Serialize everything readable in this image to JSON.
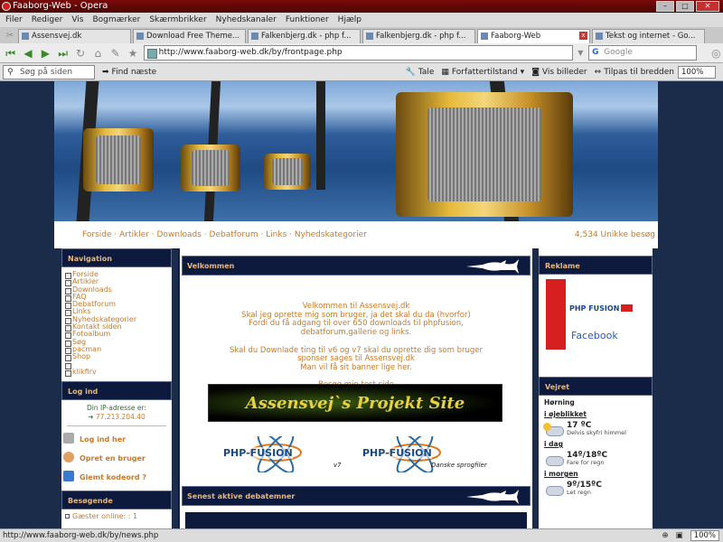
{
  "window": {
    "title": "Faaborg-Web - Opera"
  },
  "menu": [
    "Filer",
    "Rediger",
    "Vis",
    "Bogmærker",
    "Skærmbrikker",
    "Nyhedskanaler",
    "Funktioner",
    "Hjælp"
  ],
  "tabs": [
    {
      "label": "Assensvej.dk"
    },
    {
      "label": "Download Free Theme..."
    },
    {
      "label": "Falkenbjerg.dk - php f..."
    },
    {
      "label": "Falkenbjerg.dk - php f..."
    },
    {
      "label": "Faaborg-Web"
    },
    {
      "label": "Tekst og internet - Go..."
    }
  ],
  "address": {
    "url": "http://www.faaborg-web.dk/by/frontpage.php",
    "search_placeholder": "Google"
  },
  "findbar": {
    "search_placeholder": "Søg på siden",
    "find_next": "Find næste",
    "speak": "Tale",
    "author_mode": "Forfattertilstand",
    "show_images": "Vis billeder",
    "fit_width": "Tilpas til bredden",
    "zoom": "100%"
  },
  "topnav": {
    "links": "Forside · Artikler · Downloads · Debatforum · Links · Nyhedskategorier",
    "visits": "4,534 Unikke besøg"
  },
  "left": {
    "nav_title": "Navigation",
    "nav_items": [
      "Forside",
      "Artikler",
      "Downloads",
      "FAQ",
      "Debatforum",
      "Links",
      "Nyhedskategorier",
      "Kontakt siden",
      "Fotoalbum",
      "Søg",
      "pacman",
      "Shop",
      "",
      "klikfirv"
    ],
    "login_title": "Log ind",
    "ip_label": "Din IP-adresse er:",
    "ip_value": "77.213.204.40",
    "login_here": "Log ind her",
    "create_user": "Opret en bruger",
    "forgot": "Glemt kodeord ?",
    "visitors_title": "Besøgende",
    "guests": "Gæster online: : 1"
  },
  "main": {
    "welcome_title": "Velkommen",
    "welcome_lines": [
      "Velkommen til Assensvej.dk",
      "Skal jeg oprette mig som bruger, ja det skal du da (hvorfor)",
      "Fordi du få adgang til over 650 downloads til phpfusion,",
      "debatforum,gallerie og links.",
      "",
      "Skal du Downlade ting til v6 og v7 skal du oprette dig som bruger",
      "sponser sages til Assensvej.dk",
      "Man vil få sit banner lige her.",
      "",
      "Besøg min test side"
    ],
    "project_banner": "Assensvej`s Projekt Site",
    "logo1_caption": "v7",
    "logo2_caption": "Danske sprogfiler",
    "logo_text": "PHP-FUSION",
    "latest_title": "Senest aktive debatemner"
  },
  "right": {
    "ads_title": "Reklame",
    "facebook": "Facebook",
    "fusion_small": "PHP FUSION",
    "weather_title": "Vejret",
    "city": "Hørning",
    "days": [
      {
        "label": "i øjeblikket",
        "temp": "17 ºC",
        "desc": "Delvis skyfri himmel"
      },
      {
        "label": "i dag",
        "temp": "14º/18ºC",
        "desc": "Fare for regn"
      },
      {
        "label": "i morgen",
        "temp": "9º/15ºC",
        "desc": "Let regn"
      }
    ]
  },
  "status": {
    "url": "http://www.faaborg-web.dk/by/news.php",
    "zoom": "100%"
  },
  "colors": {
    "accent": "#c87a2a",
    "header_bg": "#0d1a3e",
    "page_bg": "#1b2c4a"
  }
}
